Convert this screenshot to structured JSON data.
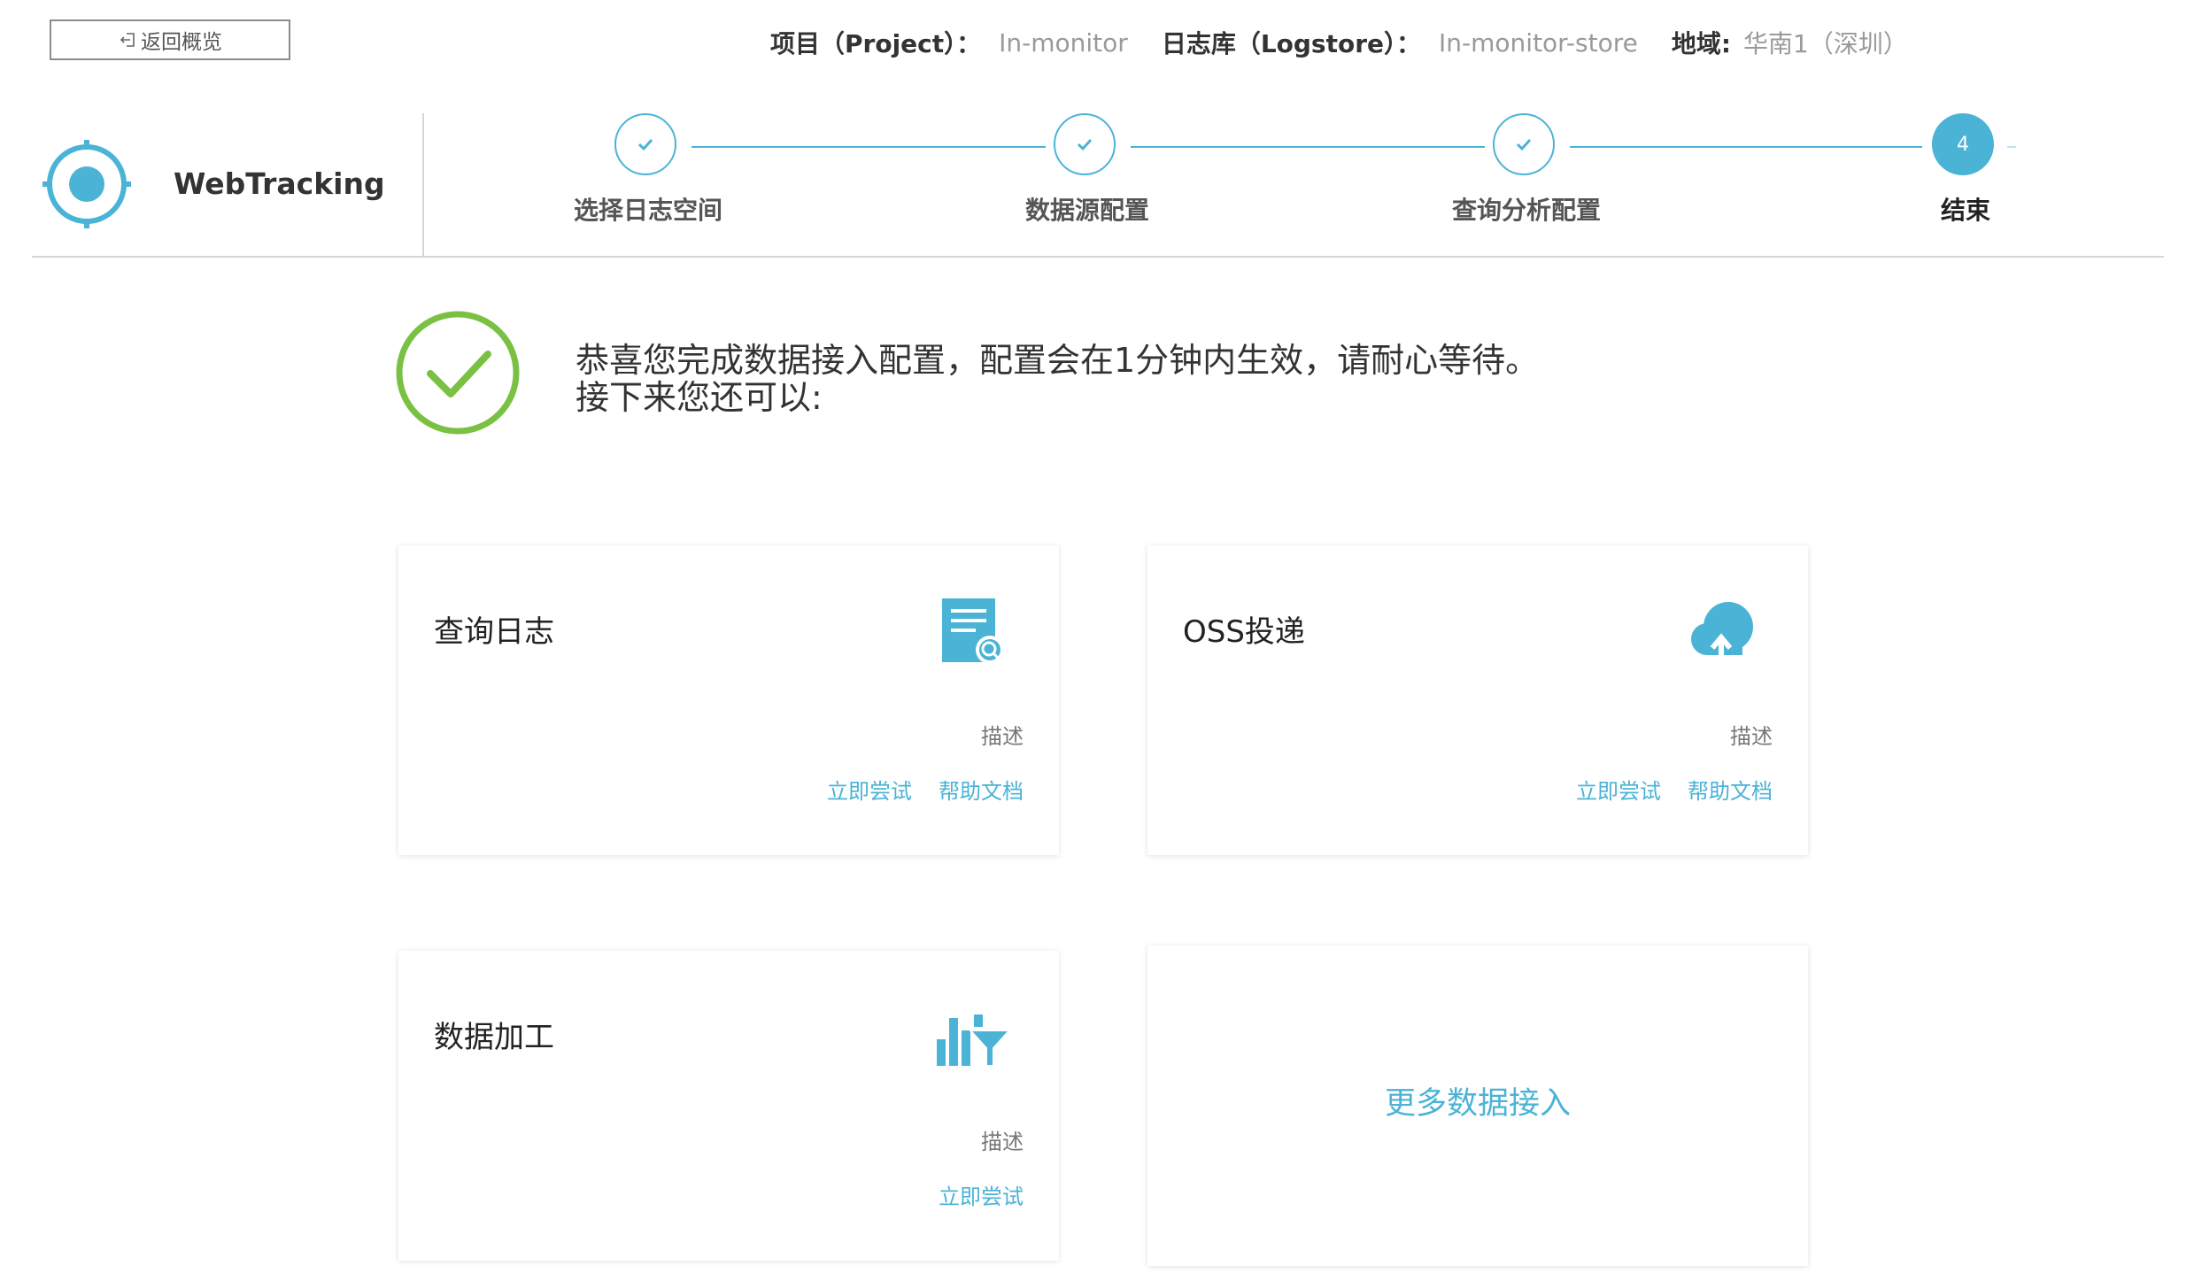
{
  "topbar": {
    "back_label": "返回概览",
    "project_label": "项目（Project）：",
    "project_value": "In-monitor",
    "logstore_label": "日志库（Logstore）：",
    "logstore_value": "In-monitor-store",
    "region_label": "地域:",
    "region_value": "华南1（深圳）"
  },
  "header": {
    "product_name": "WebTracking",
    "steps": [
      {
        "label": "选择日志空间",
        "state": "done"
      },
      {
        "label": "数据源配置",
        "state": "done"
      },
      {
        "label": "查询分析配置",
        "state": "done"
      },
      {
        "label": "结束",
        "state": "current",
        "number": "4"
      }
    ]
  },
  "message": {
    "title": "恭喜您完成数据接入配置，配置会在1分钟内生效，请耐心等待。",
    "subtitle": "接下来您还可以:"
  },
  "cards": [
    {
      "title": "查询日志",
      "icon": "log-search-icon",
      "desc": "描述",
      "links": [
        "立即尝试",
        "帮助文档"
      ]
    },
    {
      "title": "OSS投递",
      "icon": "cloud-upload-icon",
      "desc": "描述",
      "links": [
        "立即尝试",
        "帮助文档"
      ]
    },
    {
      "title": "数据加工",
      "icon": "data-process-icon",
      "desc": "描述",
      "links": [
        "立即尝试"
      ]
    },
    {
      "more_label": "更多数据接入"
    }
  ],
  "colors": {
    "accent": "#4ab3d6",
    "success": "#7ac143",
    "divider": "#d6d6d6"
  }
}
